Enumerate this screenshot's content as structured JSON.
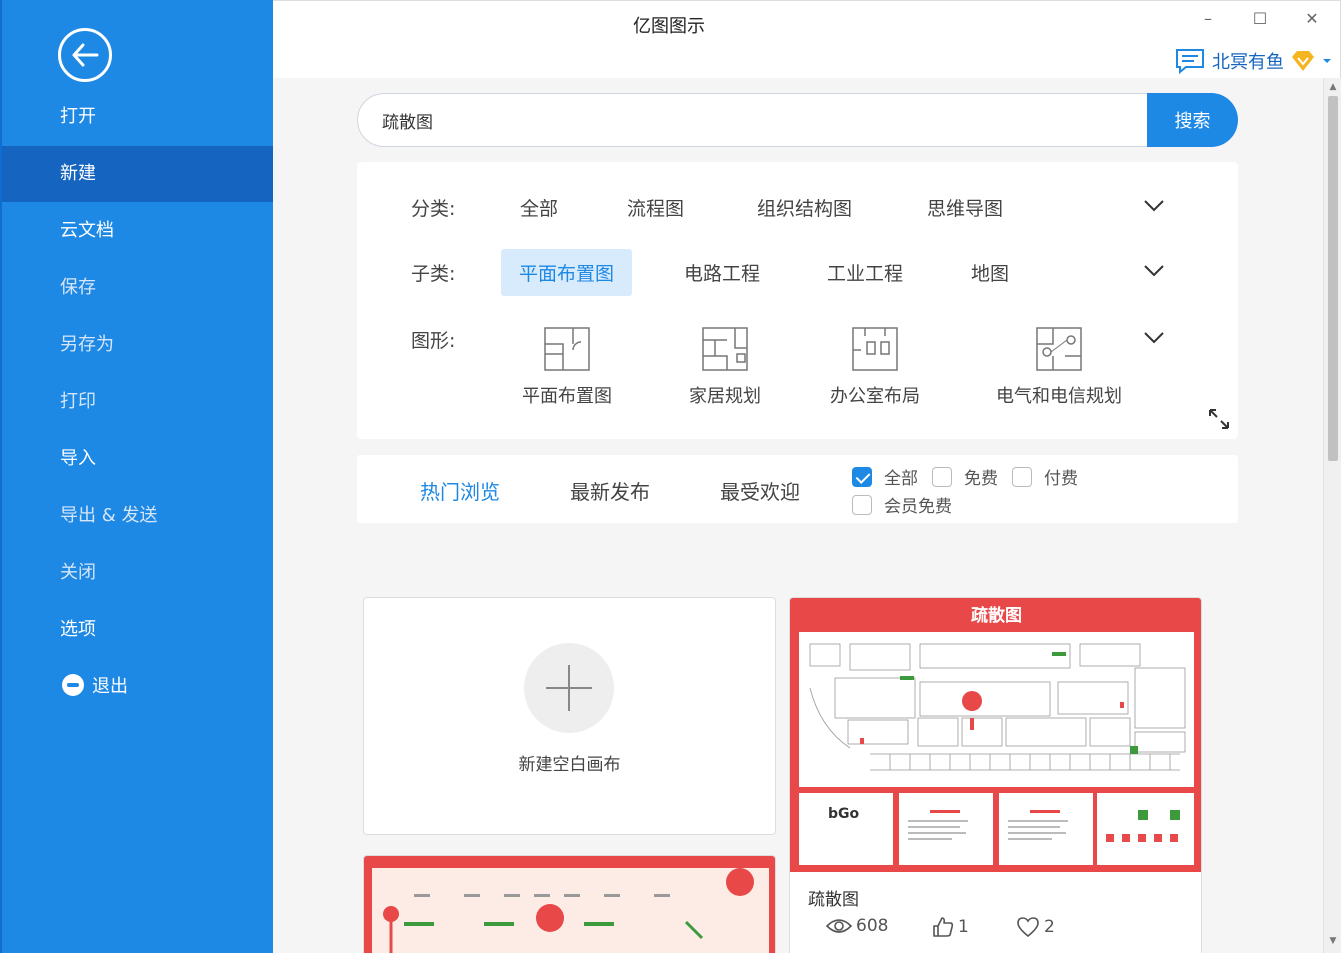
{
  "app": {
    "title": "亿图图示"
  },
  "window": {
    "minimize": "–",
    "maximize": "☐",
    "close": "✕"
  },
  "user": {
    "name": "北冥有鱼"
  },
  "sidebar": {
    "items": [
      {
        "label": "打开"
      },
      {
        "label": "新建"
      },
      {
        "label": "云文档"
      },
      {
        "label": "保存"
      },
      {
        "label": "另存为"
      },
      {
        "label": "打印"
      },
      {
        "label": "导入"
      },
      {
        "label": "导出 & 发送"
      },
      {
        "label": "关闭"
      },
      {
        "label": "选项"
      },
      {
        "label": "退出"
      }
    ]
  },
  "search": {
    "value": "疏散图",
    "button": "搜索"
  },
  "filters": {
    "category_label": "分类:",
    "categories": [
      "全部",
      "流程图",
      "组织结构图",
      "思维导图"
    ],
    "subcategory_label": "子类:",
    "subcategories": [
      "平面布置图",
      "电路工程",
      "工业工程",
      "地图"
    ],
    "shape_label": "图形:",
    "shapes": [
      "平面布置图",
      "家居规划",
      "办公室布局",
      "电气和电信规划"
    ]
  },
  "sort": {
    "tabs": [
      "热门浏览",
      "最新发布",
      "最受欢迎"
    ],
    "checkboxes": [
      {
        "label": "全部",
        "checked": true
      },
      {
        "label": "免费",
        "checked": false
      },
      {
        "label": "付费",
        "checked": false
      },
      {
        "label": "会员免费",
        "checked": false
      }
    ]
  },
  "new_blank": {
    "label": "新建空白画布"
  },
  "template": {
    "title": "疏散图",
    "thumb_title": "疏散图",
    "views": "608",
    "likes": "1",
    "favorites": "2"
  }
}
